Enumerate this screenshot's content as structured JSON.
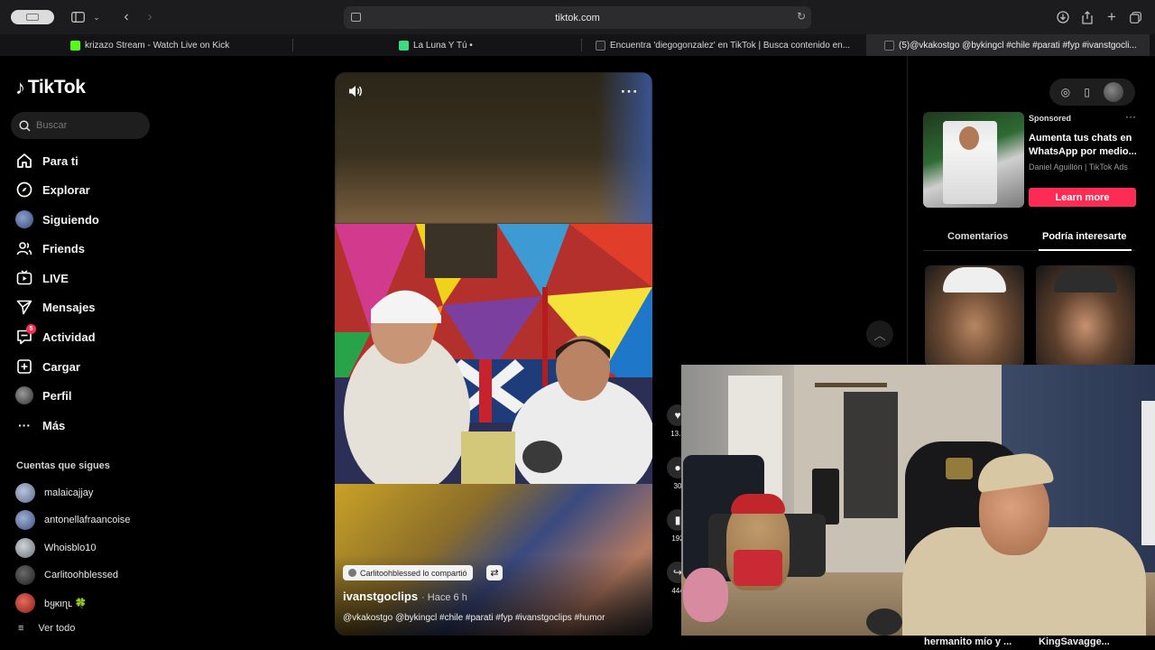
{
  "browser": {
    "url": "tiktok.com",
    "tabs": [
      {
        "title": "krizazo Stream - Watch Live on Kick",
        "fav_color": "#53fc18"
      },
      {
        "title": "La Luna Y Tú •",
        "fav_color": "#3ddc84"
      },
      {
        "title": "Encuentra 'diegogonzalez' en TikTok | Busca contenido en...",
        "fav_color": "#111111"
      },
      {
        "title": "(5)@vkakostgo @bykingcl #chile #parati #fyp #ivanstgocli...",
        "fav_color": "#111111"
      }
    ]
  },
  "sidebar": {
    "logo": "TikTok",
    "search_placeholder": "Buscar",
    "nav": [
      {
        "label": "Para ti",
        "icon": "home-icon"
      },
      {
        "label": "Explorar",
        "icon": "compass-icon"
      },
      {
        "label": "Siguiendo",
        "icon": "following-avatar-icon"
      },
      {
        "label": "Friends",
        "icon": "friends-icon"
      },
      {
        "label": "LIVE",
        "icon": "live-icon"
      },
      {
        "label": "Mensajes",
        "icon": "send-icon"
      },
      {
        "label": "Actividad",
        "icon": "activity-icon",
        "badge": "5"
      },
      {
        "label": "Cargar",
        "icon": "upload-icon"
      },
      {
        "label": "Perfil",
        "icon": "profile-avatar-icon"
      },
      {
        "label": "Más",
        "icon": "more-dots-icon"
      }
    ],
    "following_title": "Cuentas que sigues",
    "following": [
      {
        "name": "malaicajjay",
        "color": "#8a9ab8"
      },
      {
        "name": "antonellafraancoise",
        "color": "#6d7fa8"
      },
      {
        "name": "Whoisblo10",
        "color": "#9aa0a8"
      },
      {
        "name": "Carlitoohblessed",
        "color": "#555555"
      },
      {
        "name": "bყκιɳւ 🍀",
        "color": "#c0392b"
      }
    ],
    "see_all": "Ver todo"
  },
  "video": {
    "repost_text": "Carlitoohblessed lo compartió",
    "author": "ivanstgoclips",
    "time": "· Hace 6 h",
    "caption": "@vkakostgo @bykingcl #chile #parati #fyp #ivanstgoclips #humor",
    "actions": [
      {
        "icon": "heart-icon",
        "count": "13.1"
      },
      {
        "icon": "comment-icon",
        "count": "30"
      },
      {
        "icon": "bookmark-icon",
        "count": "192"
      },
      {
        "icon": "share-icon",
        "count": "444"
      }
    ]
  },
  "ad": {
    "sponsored": "Sponsored",
    "title": "Aumenta tus chats en WhatsApp por medio...",
    "advertiser": "Daniel Aguillón | TikTok Ads",
    "cta": "Learn more"
  },
  "right_tabs": [
    "Comentarios",
    "Podría interesarte"
  ],
  "bottom_captions": [
    "hermanito mío y ...",
    "KingSavagge..."
  ]
}
